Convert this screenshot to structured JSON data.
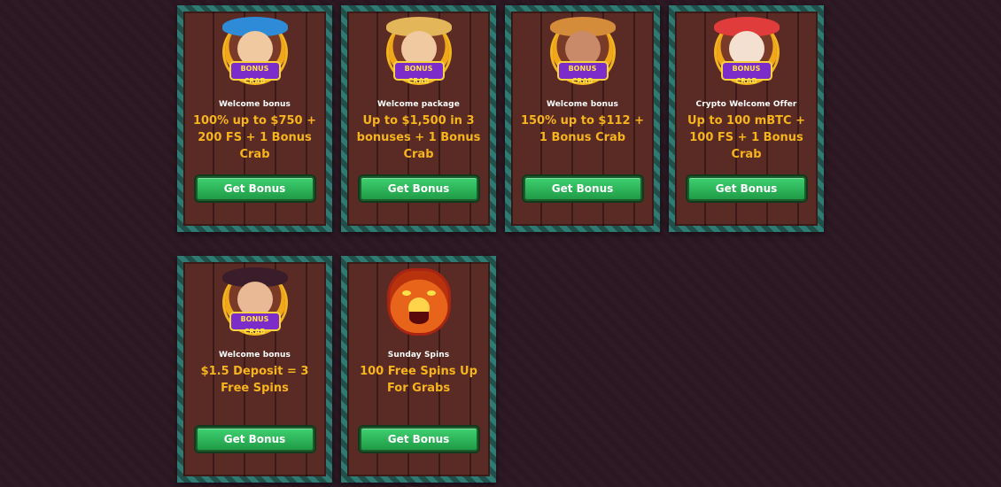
{
  "cards": [
    {
      "label": "Welcome bonus",
      "offer": "100% up to $750 + 200 FS + 1 Bonus Crab",
      "button": "Get Bonus",
      "badge": "BONUS CRAB",
      "hat_color": "#2e8bd8"
    },
    {
      "label": "Welcome package",
      "offer": "Up to $1,500 in 3 bonuses + 1 Bonus Crab",
      "button": "Get Bonus",
      "badge": "BONUS CRAB",
      "hat_color": "#e4b65a"
    },
    {
      "label": "Welcome bonus",
      "offer": "150% up to $112 + 1 Bonus Crab",
      "button": "Get Bonus",
      "badge": "BONUS CRAB",
      "hat_color": "#d48b3a"
    },
    {
      "label": "Crypto Welcome Offer",
      "offer": "Up to 100 mBTC + 100 FS + 1 Bonus Crab",
      "button": "Get Bonus",
      "badge": "BONUS CRAB",
      "hat_color": "#e03c3c"
    },
    {
      "label": "Welcome bonus",
      "offer": "$1.5 Deposit = 3 Free Spins",
      "button": "Get Bonus",
      "badge": "BONUS CRAB",
      "hat_color": "#3a1c2a"
    },
    {
      "label": "Sunday Spins",
      "offer": "100 Free Spins Up For Grabs",
      "button": "Get Bonus",
      "icon": "tiger-icon"
    }
  ],
  "colors": {
    "background": "#2b1722",
    "offer_text": "#f6b41d",
    "button_green": "#2bb55a",
    "card_border": "#2f7a72"
  }
}
